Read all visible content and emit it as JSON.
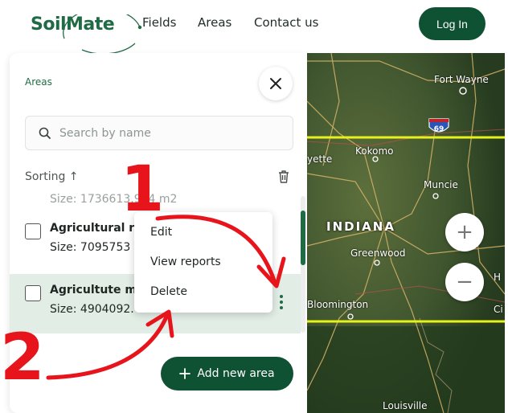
{
  "header": {
    "logo": "SoilMate",
    "nav": [
      "Fields",
      "Areas",
      "Contact us"
    ],
    "login_label": "Log In"
  },
  "panel": {
    "title": "Areas",
    "search_placeholder": "Search by name",
    "sorting_label": "Sorting ↑",
    "rows": [
      {
        "name": "",
        "size": "Size: 1736613.954 m2"
      },
      {
        "name": "Agricultural r",
        "size": "Size: 7095753"
      },
      {
        "name": "Agricultute m",
        "size": "Size: 4904092."
      }
    ],
    "add_label": "Add new area"
  },
  "context_menu": {
    "items": [
      "Edit",
      "View reports",
      "Delete"
    ]
  },
  "map": {
    "labels": {
      "fort_wayne": "Fort Wayne",
      "kokomo": "Kokomo",
      "yette": "yette",
      "muncie": "Muncie",
      "indiana": "INDIANA",
      "greenwood": "Greenwood",
      "bloomington": "Bloomington",
      "louisville": "Louisville",
      "h": "H",
      "ci": "Ci",
      "hwy": "69"
    },
    "zoom_in": "+",
    "zoom_out": "−"
  },
  "annotations": {
    "step1": "1",
    "step2": "2"
  },
  "colors": {
    "brand": "#0f5133",
    "accent_green": "#1f6b45",
    "selected_row": "#e2ede6",
    "annotation_red": "#e8141b",
    "map_boundary": "#e6f21a"
  }
}
